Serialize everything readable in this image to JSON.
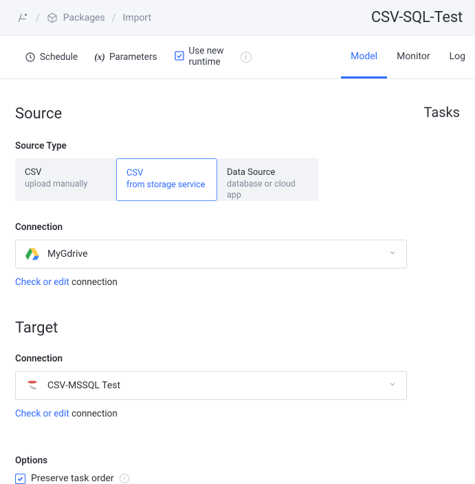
{
  "breadcrumb": {
    "packages": "Packages",
    "current": "Import"
  },
  "page_title": "CSV-SQL-Test",
  "subnav": {
    "schedule": "Schedule",
    "parameters": "Parameters",
    "use_new_runtime_l1": "Use new",
    "use_new_runtime_l2": "runtime"
  },
  "tabs": {
    "model": "Model",
    "monitor": "Monitor",
    "log": "Log"
  },
  "tasks_link": "Tasks",
  "source": {
    "heading": "Source",
    "type_label": "Source Type",
    "cards": [
      {
        "t1": "CSV",
        "t2": "upload manually"
      },
      {
        "t1": "CSV",
        "t2": "from storage service"
      },
      {
        "t1": "Data Source",
        "t2": "database or cloud app"
      }
    ],
    "connection_label": "Connection",
    "connection_value": "MyGdrive",
    "check_edit_link": "Check or edit",
    "check_edit_rest": " connection"
  },
  "target": {
    "heading": "Target",
    "connection_label": "Connection",
    "connection_value": "CSV-MSSQL Test",
    "check_edit_link": "Check or edit",
    "check_edit_rest": " connection"
  },
  "options": {
    "heading": "Options",
    "preserve_label": "Preserve task order"
  }
}
